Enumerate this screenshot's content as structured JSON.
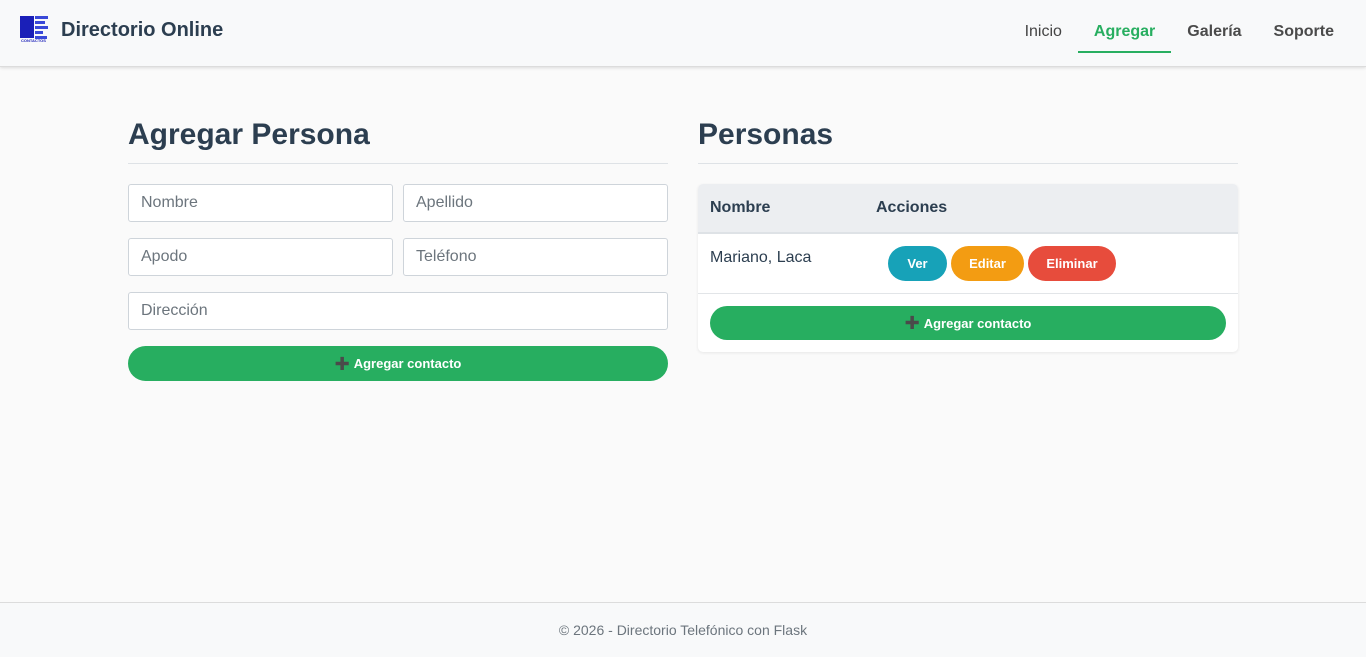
{
  "header": {
    "brand_title": "Directorio Online",
    "logo_icon": "contacts-logo-icon",
    "logo_text": "CONTACTOS",
    "nav": [
      {
        "label": "Inicio",
        "active": false
      },
      {
        "label": "Agregar",
        "active": true
      },
      {
        "label": "Galería",
        "active": false
      },
      {
        "label": "Soporte",
        "active": false
      }
    ]
  },
  "form": {
    "title": "Agregar Persona",
    "fields": {
      "nombre": {
        "placeholder": "Nombre",
        "value": ""
      },
      "apellido": {
        "placeholder": "Apellido",
        "value": ""
      },
      "apodo": {
        "placeholder": "Apodo",
        "value": ""
      },
      "telefono": {
        "placeholder": "Teléfono",
        "value": ""
      },
      "direccion": {
        "placeholder": "Dirección",
        "value": ""
      }
    },
    "submit_icon": "plus-icon",
    "submit_label": "Agregar contacto"
  },
  "people": {
    "title": "Personas",
    "columns": [
      "Nombre",
      "Acciones"
    ],
    "rows": [
      {
        "name": "Mariano, Laca",
        "actions": [
          "Ver",
          "Editar",
          "Eliminar"
        ]
      }
    ],
    "add_label": "Agregar contacto"
  },
  "footer": {
    "text": "© 2026 - Directorio Telefónico con Flask"
  },
  "colors": {
    "accent": "#27ae60",
    "info": "#17a2b8",
    "warning": "#f39c12",
    "danger": "#e74c3c",
    "heading": "#2c3e50"
  }
}
